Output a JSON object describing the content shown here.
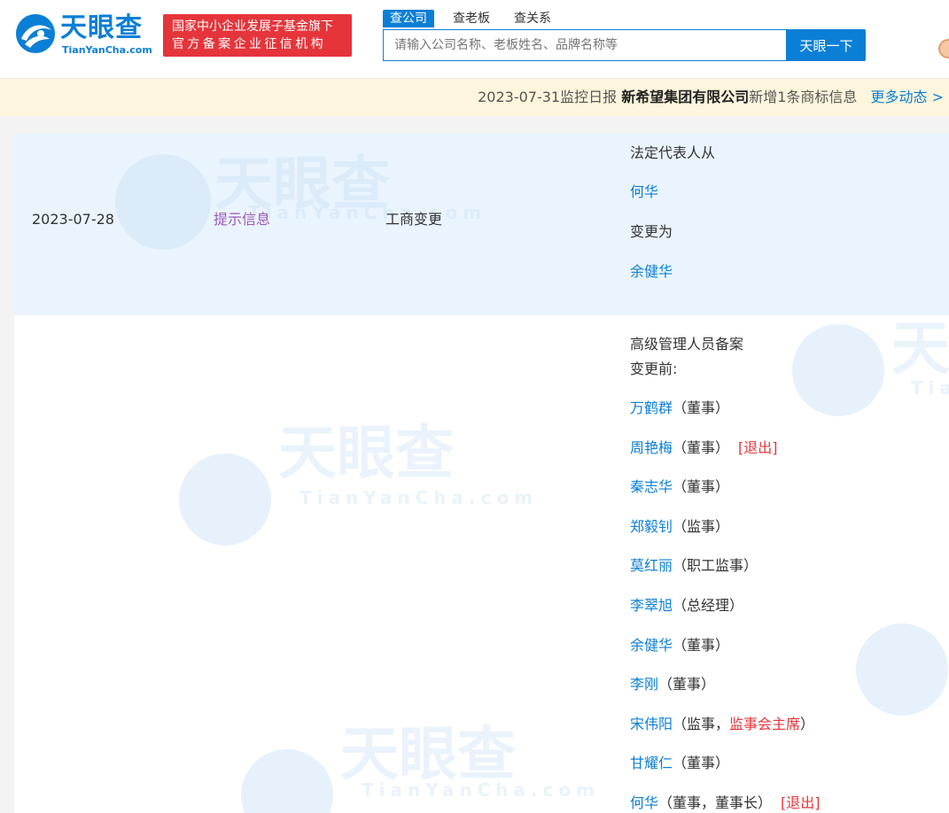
{
  "header": {
    "logo_text": "天眼查",
    "logo_sub": "TianYanCha.com",
    "gov_badge_line1": "国家中小企业发展子基金旗下",
    "gov_badge_line2": "官方备案企业征信机构",
    "tabs": [
      {
        "label": "查公司",
        "active": true
      },
      {
        "label": "查老板",
        "active": false
      },
      {
        "label": "查关系",
        "active": false
      }
    ],
    "search_placeholder": "请输入公司名称、老板姓名、品牌名称等",
    "search_button": "天眼一下"
  },
  "notice": {
    "prefix": "2023-07-31监控日报",
    "company": "新希望集团有限公司",
    "suffix": "新增1条商标信息",
    "more": "更多动态 >"
  },
  "watermark": {
    "text": "天眼查",
    "sub": "TianYanCha.com"
  },
  "record": {
    "date": "2023-07-28",
    "type": "提示信息",
    "category": "工商变更",
    "change_from_label": "法定代表人从",
    "old_person": "何华",
    "change_to_label": "变更为",
    "new_person": "余健华"
  },
  "record2": {
    "title": "高级管理人员备案",
    "before_label": "变更前:",
    "people": [
      {
        "name": "万鹤群",
        "role_pre": "（董事）",
        "role_red": "",
        "role_post": "",
        "exit": ""
      },
      {
        "name": "周艳梅",
        "role_pre": "（董事）",
        "role_red": "",
        "role_post": "",
        "exit": "[退出]"
      },
      {
        "name": "秦志华",
        "role_pre": "（董事）",
        "role_red": "",
        "role_post": "",
        "exit": ""
      },
      {
        "name": "郑毅钊",
        "role_pre": "（监事）",
        "role_red": "",
        "role_post": "",
        "exit": ""
      },
      {
        "name": "莫红丽",
        "role_pre": "（职工监事）",
        "role_red": "",
        "role_post": "",
        "exit": ""
      },
      {
        "name": "李翠旭",
        "role_pre": "（总经理）",
        "role_red": "",
        "role_post": "",
        "exit": ""
      },
      {
        "name": "余健华",
        "role_pre": "（董事）",
        "role_red": "",
        "role_post": "",
        "exit": ""
      },
      {
        "name": "李刚",
        "role_pre": "（董事）",
        "role_red": "",
        "role_post": "",
        "exit": ""
      },
      {
        "name": "宋伟阳",
        "role_pre": "（监事，",
        "role_red": "监事会主席",
        "role_post": "）",
        "exit": ""
      },
      {
        "name": "甘耀仁",
        "role_pre": "（董事）",
        "role_red": "",
        "role_post": "",
        "exit": ""
      },
      {
        "name": "何华",
        "role_pre": "（董事，董事长）",
        "role_red": "",
        "role_post": "",
        "exit": "[退出]"
      }
    ]
  },
  "colors": {
    "brand_blue": "#0b7fd6",
    "badge_red": "#e5353b",
    "notice_bg": "#fdf5dc",
    "row_highlight": "#eaf4fe",
    "tag_purple": "#9b59b6"
  }
}
